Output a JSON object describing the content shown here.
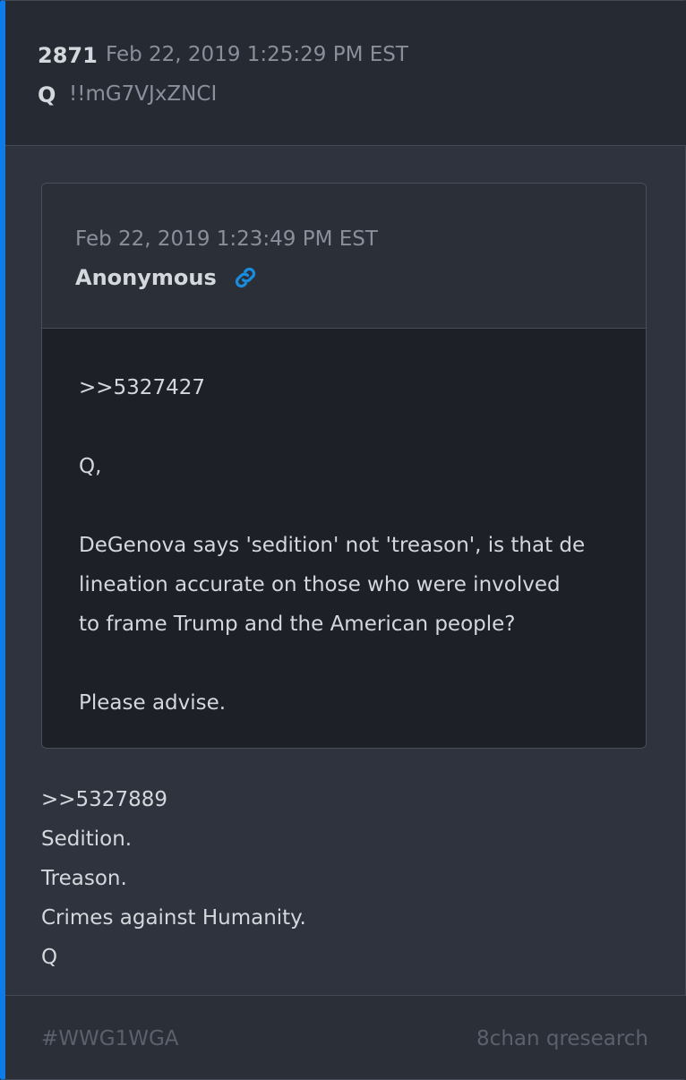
{
  "post": {
    "number": "2871",
    "date": "Feb 22, 2019 1:25:29 PM EST",
    "author": "Q",
    "tripcode": "!!mG7VJxZNCI"
  },
  "quoted": {
    "date": "Feb 22, 2019 1:23:49 PM EST",
    "author": "Anonymous",
    "link_icon": "link-icon",
    "body": [
      ">>5327427",
      "",
      "Q,",
      "",
      "DeGenova says 'sedition' not 'treason', is that de",
      "lineation accurate on those who were involved",
      "to frame Trump and the American people?",
      "",
      "Please advise."
    ]
  },
  "body": [
    ">>5327889",
    "Sedition.",
    "Treason.",
    "Crimes against Humanity.",
    "Q"
  ],
  "footer": {
    "hashtag": "#WWG1WGA",
    "source": "8chan qresearch"
  },
  "colors": {
    "accent": "#0d7be8",
    "background": "#2e333d",
    "header": "#262a33",
    "quote_body": "#1d2027",
    "text": "#d4d7dc",
    "muted": "#8a909b"
  }
}
